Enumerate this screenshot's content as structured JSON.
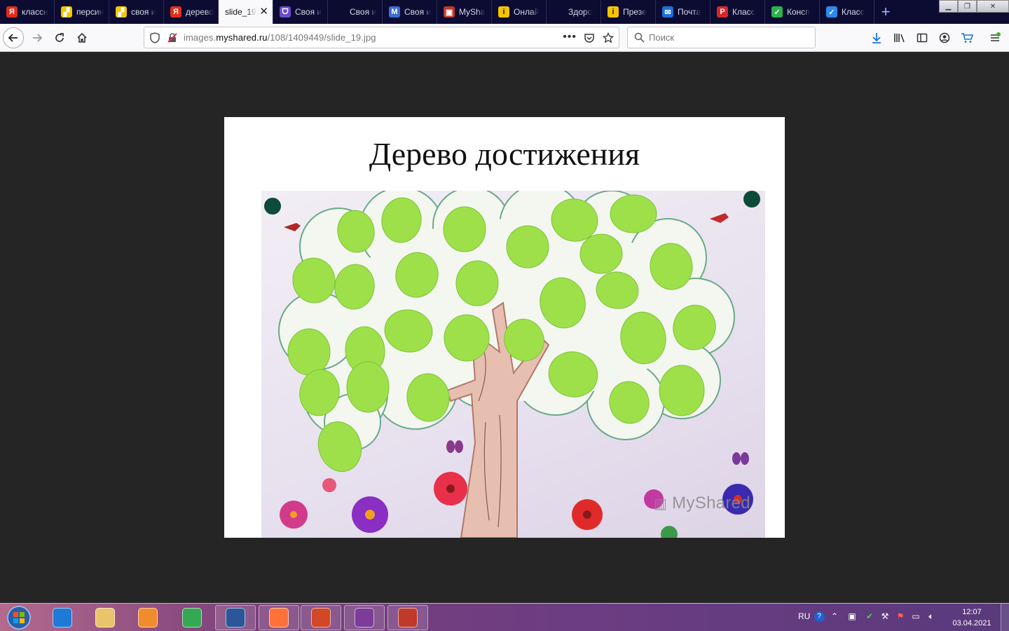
{
  "browser": {
    "tabs": [
      {
        "label": "классн",
        "favicon": "yandex-icon",
        "color": "#e32b1b",
        "glyph": "Я"
      },
      {
        "label": "персин",
        "favicon": "image-search-icon",
        "color": "#f5c400",
        "glyph": "▞"
      },
      {
        "label": "своя и",
        "favicon": "image-search-icon",
        "color": "#f5c400",
        "glyph": "▞"
      },
      {
        "label": "дерево",
        "favicon": "yandex-icon",
        "color": "#e32b1b",
        "glyph": "Я"
      },
      {
        "label": "slide_19",
        "favicon": "none",
        "color": "#f9f9fb",
        "glyph": "",
        "active": true
      },
      {
        "label": "Своя и",
        "favicon": "wave-icon",
        "color": "#6c4ccf",
        "glyph": "ᗜ"
      },
      {
        "label": "Своя и",
        "favicon": "blank-icon",
        "color": "#0c0c33",
        "glyph": ""
      },
      {
        "label": "Своя и",
        "favicon": "m-icon",
        "color": "#3b6dd1",
        "glyph": "M"
      },
      {
        "label": "MySha",
        "favicon": "myshared-icon",
        "color": "#c0392b",
        "glyph": "▣"
      },
      {
        "label": "Онлай",
        "favicon": "info-icon",
        "color": "#f5c400",
        "glyph": "i"
      },
      {
        "label": "Здоро",
        "favicon": "blank-icon",
        "color": "#0c0c33",
        "glyph": ""
      },
      {
        "label": "Презе",
        "favicon": "info-icon",
        "color": "#f5c400",
        "glyph": "i"
      },
      {
        "label": "Почта",
        "favicon": "mail-icon",
        "color": "#1e6fd9",
        "glyph": "✉"
      },
      {
        "label": "Класс",
        "favicon": "p-icon",
        "color": "#d9262b",
        "glyph": "P"
      },
      {
        "label": "Консп",
        "favicon": "check-icon",
        "color": "#2bb24c",
        "glyph": "✓"
      },
      {
        "label": "Класс",
        "favicon": "check-blue-icon",
        "color": "#2d89ef",
        "glyph": "✓"
      }
    ],
    "url_prefix": "images.",
    "url_domain": "myshared.ru",
    "url_path": "/108/1409449/slide_19.jpg",
    "search_placeholder": "Поиск"
  },
  "slide": {
    "title": "Дерево достижения",
    "watermark": "MyShared"
  },
  "taskbar": {
    "apps": [
      {
        "name": "internet-explorer-icon",
        "color": "#1f7ad6"
      },
      {
        "name": "file-explorer-icon",
        "color": "#e9c46a"
      },
      {
        "name": "media-player-icon",
        "color": "#f08c2e"
      },
      {
        "name": "chrome-icon",
        "color": "#34a853"
      },
      {
        "name": "word-icon",
        "color": "#2b579a"
      },
      {
        "name": "firefox-icon",
        "color": "#ff7139"
      },
      {
        "name": "powerpoint-icon",
        "color": "#d24726"
      },
      {
        "name": "winrar-icon",
        "color": "#7d3c98"
      },
      {
        "name": "kaspersky-icon",
        "color": "#c0392b"
      }
    ],
    "language": "RU",
    "time": "12:07",
    "date": "03.04.2021"
  }
}
